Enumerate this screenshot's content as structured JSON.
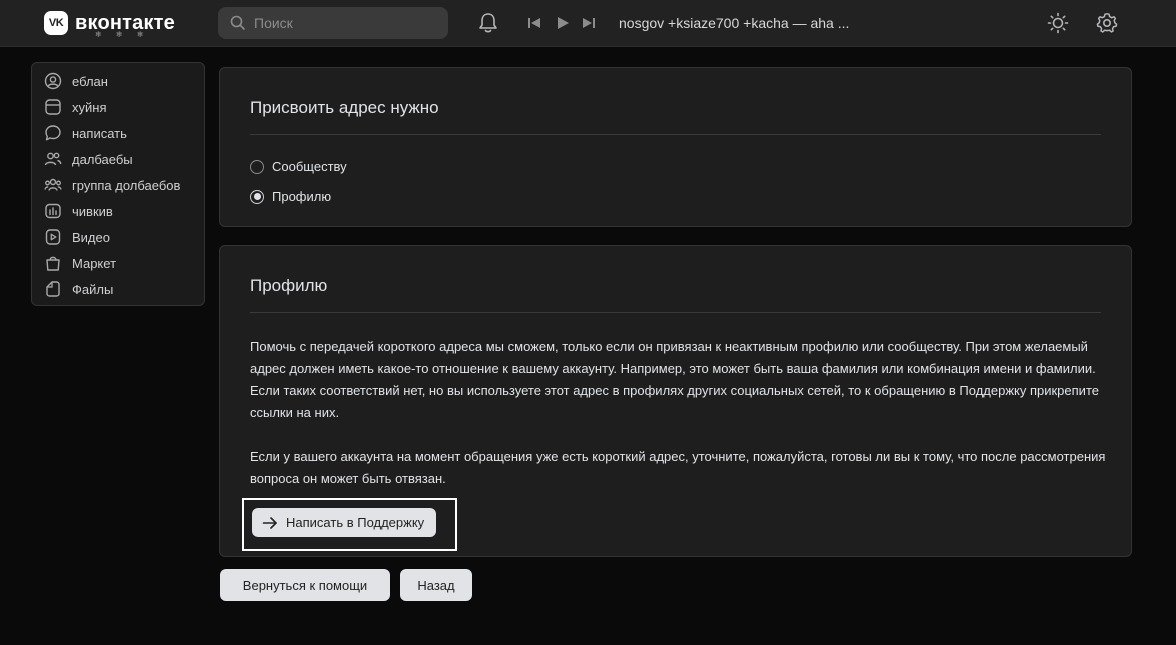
{
  "header": {
    "logo_badge": "VK",
    "logo_text": "вконтакте",
    "logo_decoration": "❄ ❄ ❄",
    "search_placeholder": "Поиск",
    "track_title": "nosgov +ksiaze700 +kacha — aha ..."
  },
  "sidebar": {
    "items": [
      {
        "label": "еблан",
        "icon": "user-circle-icon"
      },
      {
        "label": "хуйня",
        "icon": "news-icon"
      },
      {
        "label": "написать",
        "icon": "message-icon"
      },
      {
        "label": "далбаебы",
        "icon": "friends-icon"
      },
      {
        "label": "группа долбаебов",
        "icon": "community-icon"
      },
      {
        "label": "чивкив",
        "icon": "stats-icon"
      },
      {
        "label": "Видео",
        "icon": "video-icon"
      },
      {
        "label": "Маркет",
        "icon": "bag-icon"
      },
      {
        "label": "Файлы",
        "icon": "file-icon"
      }
    ]
  },
  "card1": {
    "title": "Присвоить адрес нужно",
    "options": [
      {
        "label": "Сообществу",
        "selected": false
      },
      {
        "label": "Профилю",
        "selected": true
      }
    ]
  },
  "card2": {
    "title": "Профилю",
    "paragraph1": "Помочь с передачей короткого адреса мы сможем, только если он привязан к неактивным профилю или сообществу. При этом желаемый адрес должен иметь какое-то отношение к вашему аккаунту. Например, это может быть ваша фамилия или комбинация имени и фамилии. Если таких соответствий нет, но вы используете этот адрес в профилях других социальных сетей, то к обращению в Поддержку прикрепите ссылки на них.",
    "paragraph2": "Если у вашего аккаунта на момент обращения уже есть короткий адрес, уточните, пожалуйста, готовы ли вы к тому, что после рассмотрения вопроса он может быть отвязан.",
    "support_button": "Написать в Поддержку"
  },
  "footer": {
    "back_to_help": "Вернуться к помощи",
    "back": "Назад"
  },
  "colors": {
    "background": "#0a0a0a",
    "header": "#222222",
    "card": "#1e1e1e",
    "button": "#e1e3e6",
    "highlight_border": "#ffffff"
  }
}
